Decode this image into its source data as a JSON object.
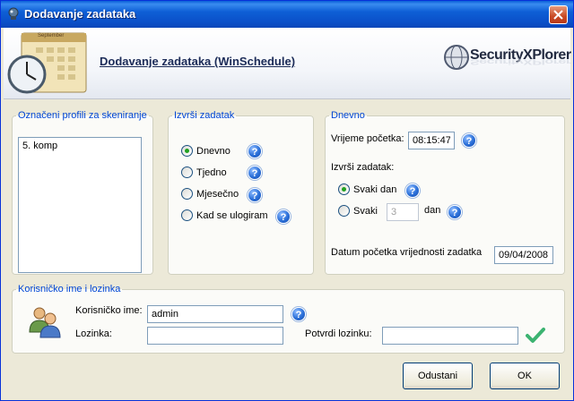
{
  "window": {
    "title": "Dodavanje zadataka"
  },
  "header": {
    "title": "Dodavanje zadataka (WinSchedule)",
    "calendar_month": "September",
    "logo_text": "SecurityXPlorer"
  },
  "profiles": {
    "legend": "Označeni profili za skeniranje",
    "items": [
      "5. komp"
    ]
  },
  "run_task": {
    "legend": "Izvrši zadatak",
    "options": [
      {
        "label": "Dnevno",
        "checked": true
      },
      {
        "label": "Tjedno",
        "checked": false
      },
      {
        "label": "Mjesečno",
        "checked": false
      },
      {
        "label": "Kad se ulogiram",
        "checked": false
      }
    ]
  },
  "daily": {
    "legend": "Dnevno",
    "start_time_label": "Vrijeme početka:",
    "start_time_value": "08:15:47",
    "run_label": "Izvrši zadatak:",
    "every_day_label": "Svaki dan",
    "every_label": "Svaki",
    "every_value": "3",
    "days_label": "dan",
    "start_date_label": "Datum početka vrijednosti zadatka",
    "start_date_value": "09/04/2008"
  },
  "credentials": {
    "legend": "Korisničko ime i lozinka",
    "username_label": "Korisničko ime:",
    "username_value": "admin",
    "password_label": "Lozinka:",
    "password_value": "",
    "confirm_label": "Potvrdi lozinku:",
    "confirm_value": ""
  },
  "buttons": {
    "cancel": "Odustani",
    "ok": "OK"
  },
  "help_glyph": "?",
  "colors": {
    "title_bar": "#0a5fd8",
    "legend": "#0046d5",
    "help": "#2a6fd8",
    "check": "#3cb371"
  }
}
